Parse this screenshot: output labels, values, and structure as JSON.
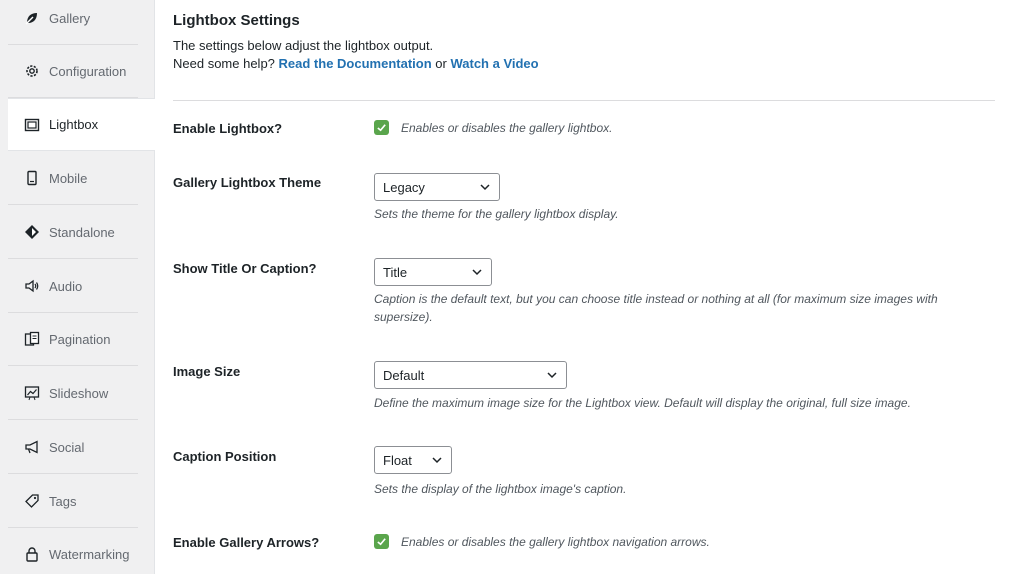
{
  "sidebar": {
    "items": [
      {
        "label": "Gallery",
        "icon": "leaf-icon"
      },
      {
        "label": "Configuration",
        "icon": "gear-icon"
      },
      {
        "label": "Lightbox",
        "icon": "lightbox-icon",
        "active": true
      },
      {
        "label": "Mobile",
        "icon": "mobile-icon"
      },
      {
        "label": "Standalone",
        "icon": "standalone-icon"
      },
      {
        "label": "Audio",
        "icon": "audio-icon"
      },
      {
        "label": "Pagination",
        "icon": "pagination-icon"
      },
      {
        "label": "Slideshow",
        "icon": "slideshow-icon"
      },
      {
        "label": "Social",
        "icon": "megaphone-icon"
      },
      {
        "label": "Tags",
        "icon": "tag-icon"
      },
      {
        "label": "Watermarking",
        "icon": "lock-icon"
      }
    ]
  },
  "main": {
    "title": "Lightbox Settings",
    "intro": "The settings below adjust the lightbox output.",
    "help_prefix": "Need some help?",
    "help_link1": "Read the Documentation",
    "help_or": "or",
    "help_link2": "Watch a Video",
    "settings": {
      "enable_lightbox": {
        "label": "Enable Lightbox?",
        "checked": true,
        "description": "Enables or disables the gallery lightbox."
      },
      "theme": {
        "label": "Gallery Lightbox Theme",
        "value": "Legacy",
        "description": "Sets the theme for the gallery lightbox display."
      },
      "title_caption": {
        "label": "Show Title Or Caption?",
        "value": "Title",
        "description1": "Caption is the default text, but you can choose title instead or nothing at all (for maximum size images with",
        "description2": "supersize)."
      },
      "image_size": {
        "label": "Image Size",
        "value": "Default",
        "description": "Define the maximum image size for the Lightbox view. Default will display the original, full size image."
      },
      "caption_position": {
        "label": "Caption Position",
        "value": "Float",
        "description": "Sets the display of the lightbox image's caption."
      },
      "enable_arrows": {
        "label": "Enable Gallery Arrows?",
        "checked": true,
        "description": "Enables or disables the gallery lightbox navigation arrows."
      }
    }
  },
  "colors": {
    "accent": "#2271b1",
    "checkbox": "#5aa54c"
  }
}
